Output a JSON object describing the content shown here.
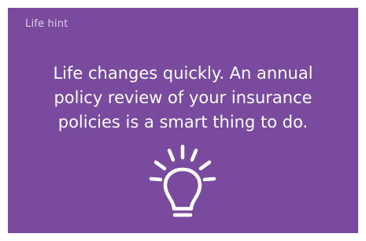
{
  "card": {
    "label": "Life hint",
    "message_lines": [
      "Life changes quickly. An annual",
      "policy review of your insurance",
      "policies is a smart thing to do."
    ],
    "icon": "lightbulb-icon",
    "background_color": "#7a4a9e",
    "text_color": "#ffffff",
    "label_color": "#ddd0ea"
  }
}
